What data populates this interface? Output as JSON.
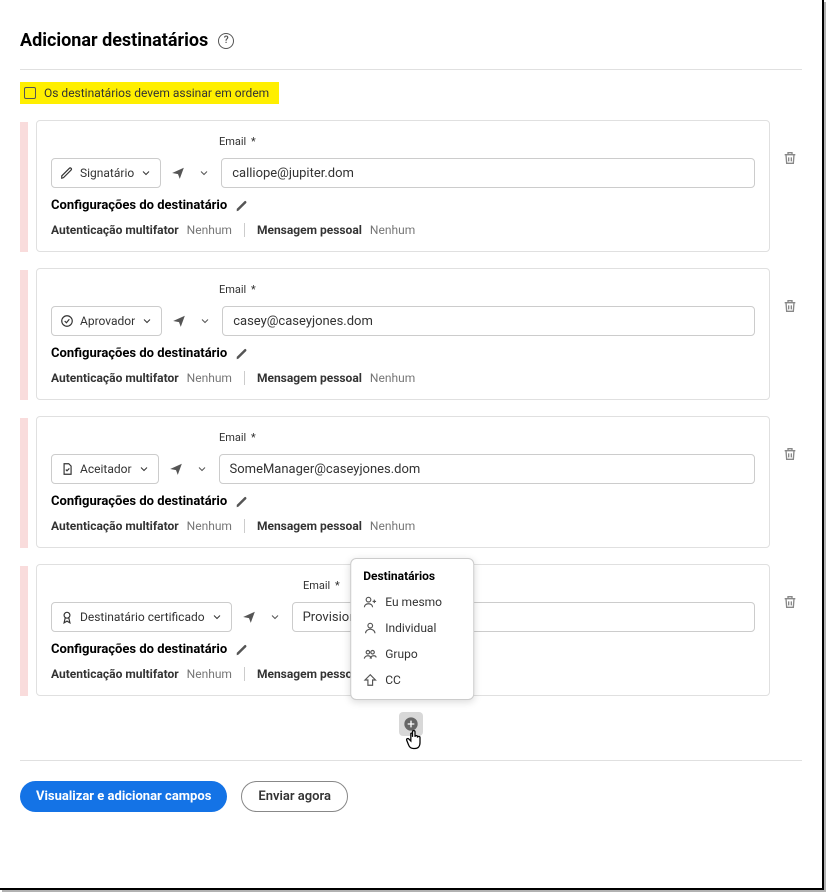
{
  "header": {
    "title": "Adicionar destinatários"
  },
  "sign_order": {
    "label": "Os destinatários devem assinar em ordem"
  },
  "labels": {
    "email_label": "Email",
    "required_mark": "*",
    "settings_title": "Configurações do destinatário",
    "mfa_label": "Autenticação multifator",
    "mfa_value": "Nenhum",
    "personal_msg_label": "Mensagem pessoal",
    "personal_msg_value": "Nenhum"
  },
  "recipients": [
    {
      "role": "Signatário",
      "role_icon": "pen-icon",
      "email": "calliope@jupiter.dom",
      "wide_role": false
    },
    {
      "role": "Aprovador",
      "role_icon": "check-circle-icon",
      "email": "casey@caseyjones.dom",
      "wide_role": false
    },
    {
      "role": "Aceitador",
      "role_icon": "accept-doc-icon",
      "email": "SomeManager@caseyjones.dom",
      "wide_role": false
    },
    {
      "role": "Destinatário certificado",
      "role_icon": "ribbon-icon",
      "email": "Provisioning@caseyjone",
      "wide_role": true
    }
  ],
  "popup": {
    "title": "Destinatários",
    "items": [
      {
        "label": "Eu mesmo",
        "icon": "user-plus-icon"
      },
      {
        "label": "Individual",
        "icon": "user-icon"
      },
      {
        "label": "Grupo",
        "icon": "group-icon"
      },
      {
        "label": "CC",
        "icon": "nav-arrow-icon"
      }
    ]
  },
  "footer": {
    "primary": "Visualizar e adicionar campos",
    "secondary": "Enviar agora"
  }
}
